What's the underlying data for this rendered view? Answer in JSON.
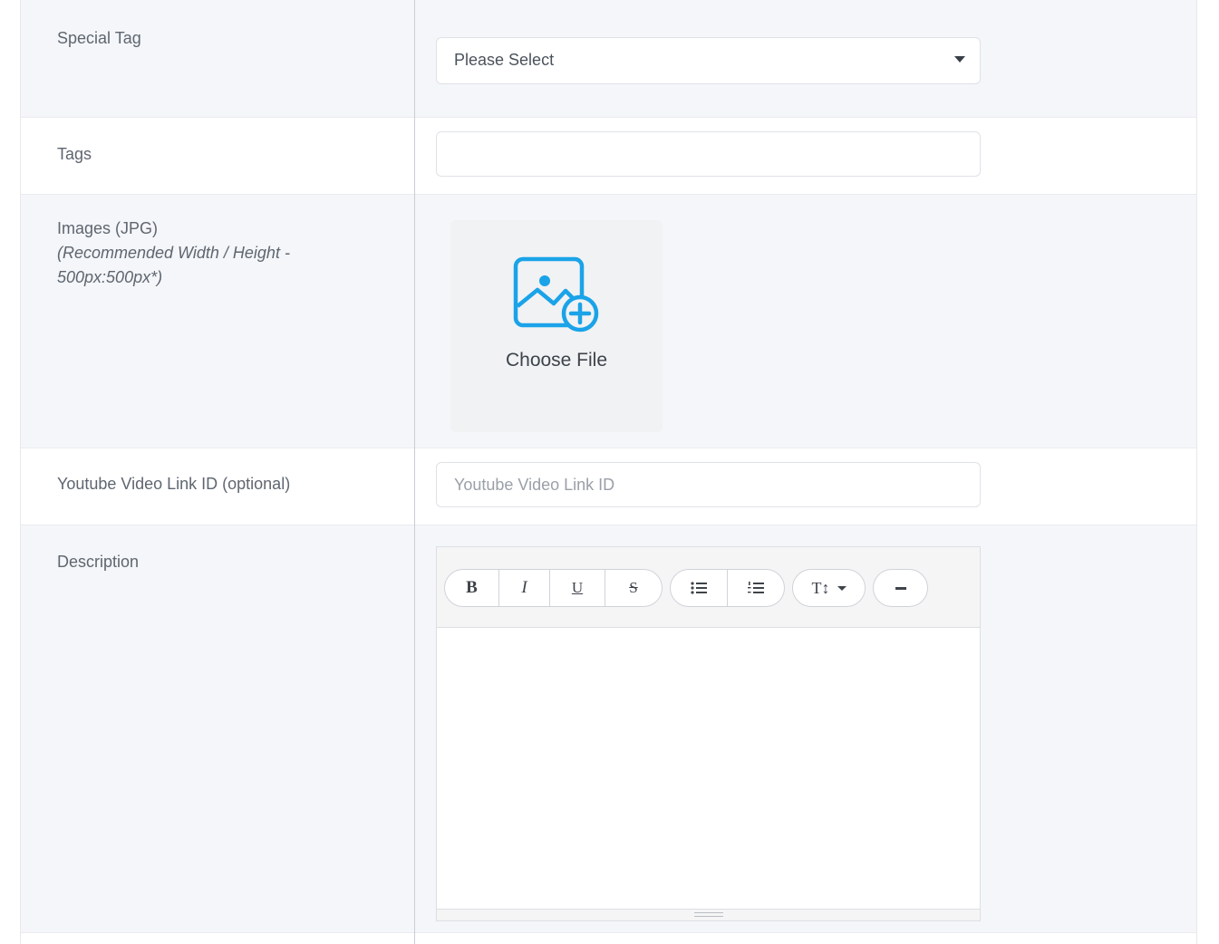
{
  "fields": {
    "special_tag": {
      "label": "Special Tag",
      "selected": "Please Select"
    },
    "tags": {
      "label": "Tags",
      "value": "",
      "placeholder": ""
    },
    "images": {
      "label": "Images (JPG)",
      "hint": "(Recommended Width / Height - 500px:500px*)",
      "button_label": "Choose File",
      "icon": "image-add-icon"
    },
    "youtube": {
      "label": "Youtube Video Link ID (optional)",
      "placeholder": "Youtube Video Link ID",
      "value": ""
    },
    "description": {
      "label": "Description",
      "toolbar": {
        "bold": "B",
        "italic": "I",
        "underline": "U",
        "strikethrough": "S",
        "font_size": "T↕",
        "icons": [
          "unordered-list-icon",
          "ordered-list-icon",
          "font-size-icon",
          "horizontal-rule-icon"
        ]
      }
    }
  },
  "colors": {
    "accent": "#1aa3e8",
    "row_alt": "#f4f6f9"
  }
}
